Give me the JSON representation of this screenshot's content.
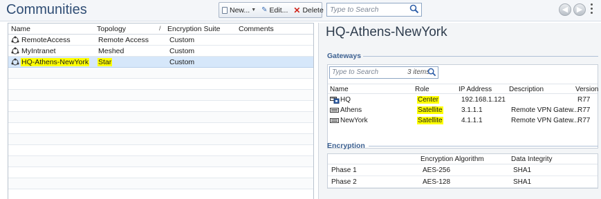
{
  "header": {
    "title": "Communities",
    "toolbar": {
      "new_label": "New...",
      "edit_label": "Edit...",
      "delete_label": "Delete"
    },
    "search_placeholder": "Type to Search"
  },
  "communities": {
    "columns": {
      "name": "Name",
      "topology": "Topology",
      "encryption": "Encryption Suite",
      "comments": "Comments"
    },
    "rows": [
      {
        "name": "RemoteAccess",
        "topology": "Remote Access",
        "encryption": "Custom",
        "comments": ""
      },
      {
        "name": "MyIntranet",
        "topology": "Meshed",
        "encryption": "Custom",
        "comments": ""
      },
      {
        "name": "HQ-Athens-NewYork",
        "topology": "Star",
        "encryption": "Custom",
        "comments": "",
        "selected": true,
        "highlighted": true
      }
    ]
  },
  "details": {
    "title": "HQ-Athens-NewYork",
    "gateways": {
      "section_label": "Gateways",
      "search_placeholder": "Type to Search",
      "count_label": "3 items",
      "columns": {
        "name": "Name",
        "role": "Role",
        "ip": "IP Address",
        "description": "Description",
        "version": "Version"
      },
      "rows": [
        {
          "icon": "cluster-icon",
          "name": "HQ",
          "role": "Center",
          "ip": "192.168.1.121",
          "description": "",
          "version": "R77"
        },
        {
          "icon": "gateway-icon",
          "name": "Athens",
          "role": "Satellite",
          "ip": "3.1.1.1",
          "description": "Remote VPN Gatew...",
          "version": "R77"
        },
        {
          "icon": "gateway-icon",
          "name": "NewYork",
          "role": "Satellite",
          "ip": "4.1.1.1",
          "description": "Remote VPN Gatew...",
          "version": "R77"
        }
      ]
    },
    "encryption": {
      "section_label": "Encryption",
      "columns": {
        "phase": "",
        "algorithm": "Encryption Algorithm",
        "integrity": "Data Integrity"
      },
      "rows": [
        {
          "phase": "Phase 1",
          "algorithm": "AES-256",
          "integrity": "SHA1"
        },
        {
          "phase": "Phase 2",
          "algorithm": "AES-128",
          "integrity": "SHA1"
        }
      ]
    }
  },
  "colors": {
    "title": "#2f4d74",
    "section": "#3d6191",
    "selection": "#d6e7fa",
    "highlight": "#ffff00"
  }
}
